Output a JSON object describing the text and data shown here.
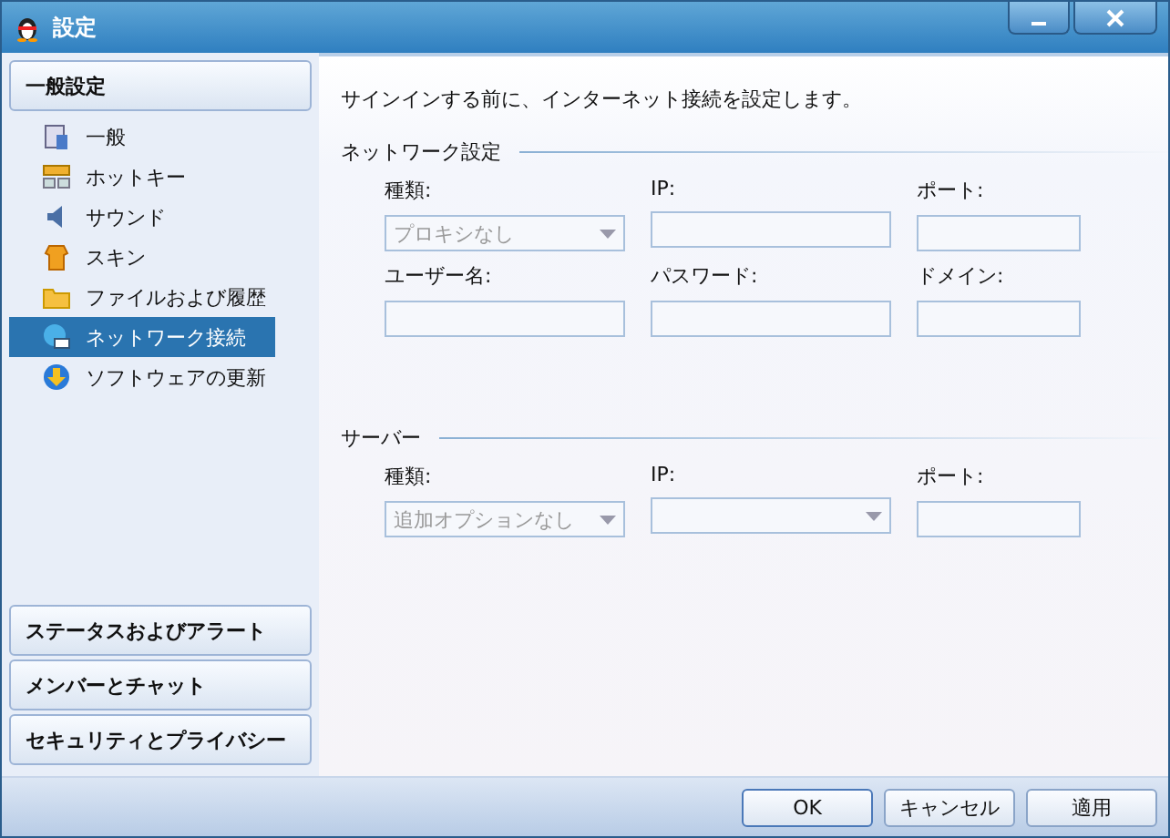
{
  "window": {
    "title": "設定"
  },
  "sidebar": {
    "main_section": "一般設定",
    "items": [
      {
        "label": "一般",
        "selected": false
      },
      {
        "label": "ホットキー",
        "selected": false
      },
      {
        "label": "サウンド",
        "selected": false
      },
      {
        "label": "スキン",
        "selected": false
      },
      {
        "label": "ファイルおよび履歴",
        "selected": false
      },
      {
        "label": "ネットワーク接続",
        "selected": true
      },
      {
        "label": "ソフトウェアの更新",
        "selected": false
      }
    ],
    "other_sections": [
      "ステータスおよびアラート",
      "メンバーとチャット",
      "セキュリティとプライバシー"
    ]
  },
  "content": {
    "description": "サインインする前に、インターネット接続を設定します。",
    "sections": [
      {
        "title": "ネットワーク設定",
        "fields": [
          {
            "label": "種類:",
            "kind": "dropdown",
            "value": "プロキシなし"
          },
          {
            "label": "IP:",
            "kind": "text"
          },
          {
            "label": "ポート:",
            "kind": "text"
          },
          {
            "label": "ユーザー名:",
            "kind": "text"
          },
          {
            "label": "パスワード:",
            "kind": "text"
          },
          {
            "label": "ドメイン:",
            "kind": "text"
          }
        ]
      },
      {
        "title": "サーバー",
        "fields": [
          {
            "label": "種類:",
            "kind": "dropdown",
            "value": "追加オプションなし"
          },
          {
            "label": "IP:",
            "kind": "dropdown"
          },
          {
            "label": "ポート:",
            "kind": "text"
          }
        ]
      }
    ]
  },
  "buttons": [
    "OK",
    "キャンセル",
    "適用"
  ]
}
